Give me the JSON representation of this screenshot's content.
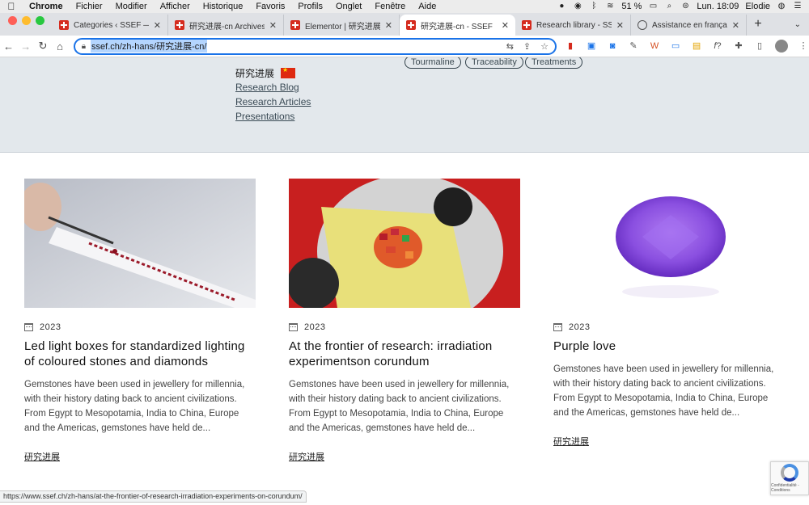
{
  "menubar": {
    "app": "Chrome",
    "items": [
      "Fichier",
      "Modifier",
      "Afficher",
      "Historique",
      "Favoris",
      "Profils",
      "Onglet",
      "Fenêtre",
      "Aide"
    ],
    "battery": "51 %",
    "clock": "Lun. 18:09",
    "user": "Elodie"
  },
  "tabs": [
    {
      "label": "Categories ‹ SSEF — Wo",
      "favicon": "swiss-flag",
      "active": false
    },
    {
      "label": "研究进展-cn Archives - S",
      "favicon": "swiss-flag",
      "active": false
    },
    {
      "label": "Elementor | 研究进展-cn",
      "favicon": "swiss-flag",
      "active": false
    },
    {
      "label": "研究进展-cn - SSEF",
      "favicon": "swiss-flag",
      "active": true
    },
    {
      "label": "Research library - SSEF",
      "favicon": "swiss-flag",
      "active": false
    },
    {
      "label": "Assistance en français -",
      "favicon": "google",
      "active": false
    }
  ],
  "toolbar": {
    "url": "ssef.ch/zh-hans/研究进展-cn/"
  },
  "topband": {
    "pills": [
      "Tourmaline",
      "Traceability",
      "Treatments"
    ],
    "nav_current": "研究进展",
    "nav_links": [
      "Research Blog",
      "Research Articles",
      "Presentations"
    ]
  },
  "cards": [
    {
      "year": "2023",
      "title": "Led light boxes for standardized lighting of coloured stones and diamonds",
      "excerpt": "Gemstones have been used in jewellery for millennia, with their history dating back to ancient civilizations. From Egypt to Mesopotamia, India to China, Europe and the Americas, gemstones have held de...",
      "more": "研究进展"
    },
    {
      "year": "2023",
      "title": "At the frontier of research: irradiation experimentson corundum",
      "excerpt": "Gemstones have been used in jewellery for millennia, with their history dating back to ancient civilizations. From Egypt to Mesopotamia, India to China, Europe and the Americas, gemstones have held de...",
      "more": "研究进展"
    },
    {
      "year": "2023",
      "title": "Purple love",
      "excerpt": "Gemstones have been used in jewellery for millennia, with their history dating back to ancient civilizations. From Egypt to Mesopotamia, India to China, Europe and the Americas, gemstones have held de...",
      "more": "研究进展"
    }
  ],
  "statusbar": "https://www.ssef.ch/zh-hans/at-the-frontier-of-research-irradiation-experiments-on-corundum/",
  "recaptcha": "Confidentialité - Conditions",
  "colors": {
    "accent": "#1a73e8",
    "band": "#e3e8ec",
    "swiss_red": "#d52b1e"
  }
}
